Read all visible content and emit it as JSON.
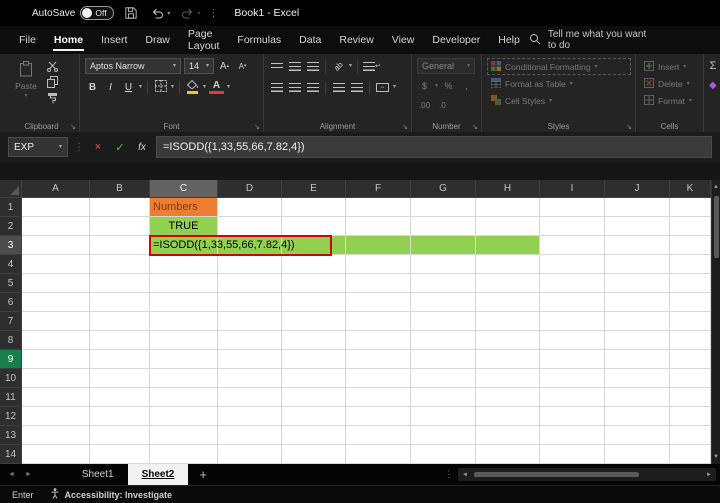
{
  "titlebar": {
    "autosave_label": "AutoSave",
    "autosave_state": "Off",
    "doc_title": "Book1 - Excel"
  },
  "menubar": {
    "items": [
      "File",
      "Home",
      "Insert",
      "Draw",
      "Page Layout",
      "Formulas",
      "Data",
      "Review",
      "View",
      "Developer",
      "Help"
    ],
    "active": "Home",
    "search_text": "Tell me what you want to do"
  },
  "ribbon": {
    "groups": [
      "Clipboard",
      "Font",
      "Alignment",
      "Number",
      "Styles",
      "Cells"
    ],
    "clipboard": {
      "paste_label": "Paste"
    },
    "font": {
      "name": "Aptos Narrow",
      "size": "14",
      "bold": "B",
      "italic": "I",
      "underline": "U",
      "increase": "A",
      "decrease": "A"
    },
    "alignment": {
      "orientation": "ab"
    },
    "number": {
      "format": "General",
      "currency": "$",
      "percent": "%",
      "comma": ",",
      "increase_decimal": ".00",
      "decrease_decimal": ".0"
    },
    "styles": {
      "conditional_formatting": "Conditional Formatting",
      "format_as_table": "Format as Table",
      "cell_styles": "Cell Styles"
    },
    "cells": {
      "insert": "Insert",
      "delete": "Delete",
      "format": "Format"
    }
  },
  "formula_bar": {
    "name_box": "EXP",
    "fx_label": "fx",
    "formula": "=ISODD({1,33,55,66,7.82,4})"
  },
  "grid": {
    "columns": [
      "A",
      "B",
      "C",
      "D",
      "E",
      "F",
      "G",
      "H",
      "I",
      "J",
      "K"
    ],
    "rows": [
      "1",
      "2",
      "3",
      "4",
      "5",
      "6",
      "7",
      "8",
      "9",
      "10",
      "11",
      "12",
      "13",
      "14"
    ],
    "selected_column": "C",
    "active_row": "3",
    "highlighted_row": "9",
    "colors": {
      "green_fill": "#92D050",
      "orange_fill": "#ED7D31",
      "orange_text": "#843C0C",
      "active_outline": "#D60000"
    },
    "cells": [
      {
        "ref": "C1",
        "text": "Numbers",
        "fill": "green_fill_none",
        "bg": "orange_fill",
        "color": "orange_text",
        "align": "left"
      },
      {
        "ref": "C2",
        "text": "TRUE",
        "bg": "green_fill",
        "align": "center"
      },
      {
        "ref": "C3",
        "text": "=ISODD({1,33,55,66,7.82,4})",
        "bg": "green_fill",
        "align": "left",
        "overflow": true,
        "outlined": true
      },
      {
        "ref": "D3",
        "bg": "green_fill"
      },
      {
        "ref": "E3",
        "bg": "green_fill"
      },
      {
        "ref": "F3",
        "bg": "green_fill"
      },
      {
        "ref": "G3",
        "bg": "green_fill"
      },
      {
        "ref": "H3",
        "bg": "green_fill"
      }
    ]
  },
  "sheet_tabs": {
    "tabs": [
      "Sheet1",
      "Sheet2"
    ],
    "active": "Sheet2",
    "add_label": "+"
  },
  "status_bar": {
    "mode": "Enter",
    "accessibility": "Accessibility: Investigate"
  }
}
